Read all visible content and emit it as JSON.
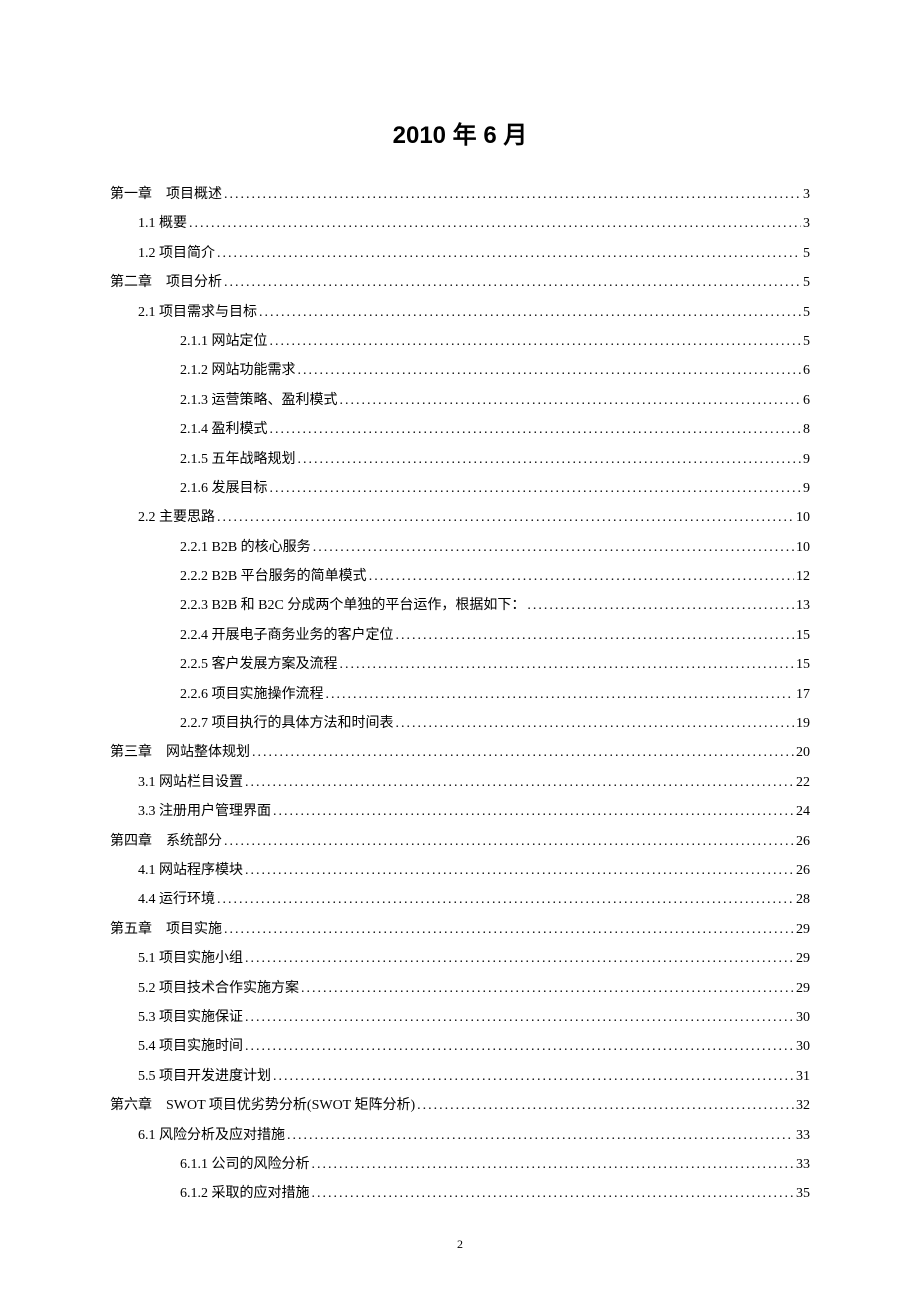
{
  "title": "2010 年 6 月",
  "page_number": "2",
  "toc": [
    {
      "level": 0,
      "label": "第一章　项目概述",
      "page": "3"
    },
    {
      "level": 1,
      "label": "1.1 概要",
      "page": "3"
    },
    {
      "level": 1,
      "label": "1.2 项目简介",
      "page": "5"
    },
    {
      "level": 0,
      "label": "第二章　项目分析",
      "page": "5"
    },
    {
      "level": 1,
      "label": "2.1 项目需求与目标",
      "page": "5"
    },
    {
      "level": 2,
      "label": "2.1.1 网站定位",
      "page": "5"
    },
    {
      "level": 2,
      "label": "2.1.2 网站功能需求",
      "page": "6"
    },
    {
      "level": 2,
      "label": "2.1.3 运营策略、盈利模式",
      "page": "6"
    },
    {
      "level": 2,
      "label": "2.1.4 盈利模式",
      "page": "8"
    },
    {
      "level": 2,
      "label": "2.1.5 五年战略规划",
      "page": "9"
    },
    {
      "level": 2,
      "label": "2.1.6 发展目标",
      "page": "9"
    },
    {
      "level": 1,
      "label": "2.2 主要思路",
      "page": "10"
    },
    {
      "level": 2,
      "label": "2.2.1 B2B 的核心服务",
      "page": "10"
    },
    {
      "level": 2,
      "label": "2.2.2 B2B 平台服务的简单模式",
      "page": "12"
    },
    {
      "level": 2,
      "label": "2.2.3 B2B 和 B2C 分成两个单独的平台运作，根据如下：",
      "page": "13"
    },
    {
      "level": 2,
      "label": "2.2.4 开展电子商务业务的客户定位",
      "page": "15"
    },
    {
      "level": 2,
      "label": "2.2.5 客户发展方案及流程",
      "page": "15"
    },
    {
      "level": 2,
      "label": "2.2.6 项目实施操作流程",
      "page": "17"
    },
    {
      "level": 2,
      "label": "2.2.7 项目执行的具体方法和时间表",
      "page": "19"
    },
    {
      "level": 0,
      "label": "第三章　网站整体规划",
      "page": "20"
    },
    {
      "level": 1,
      "label": "3.1 网站栏目设置",
      "page": "22"
    },
    {
      "level": 1,
      "label": "3.3 注册用户管理界面",
      "page": "24"
    },
    {
      "level": 0,
      "label": "第四章　系统部分",
      "page": "26"
    },
    {
      "level": 1,
      "label": "4.1 网站程序模块",
      "page": "26"
    },
    {
      "level": 1,
      "label": "4.4 运行环境",
      "page": "28"
    },
    {
      "level": 0,
      "label": "第五章　项目实施",
      "page": "29"
    },
    {
      "level": 1,
      "label": "5.1 项目实施小组",
      "page": "29"
    },
    {
      "level": 1,
      "label": "5.2 项目技术合作实施方案",
      "page": "29"
    },
    {
      "level": 1,
      "label": "5.3 项目实施保证",
      "page": "30"
    },
    {
      "level": 1,
      "label": "5.4 项目实施时间",
      "page": "30"
    },
    {
      "level": 1,
      "label": "5.5 项目开发进度计划",
      "page": "31"
    },
    {
      "level": 0,
      "label": "第六章　SWOT 项目优劣势分析(SWOT 矩阵分析)",
      "page": "32"
    },
    {
      "level": 1,
      "label": "6.1 风险分析及应对措施",
      "page": "33"
    },
    {
      "level": 2,
      "label": "6.1.1 公司的风险分析",
      "page": "33"
    },
    {
      "level": 2,
      "label": "6.1.2 采取的应对措施",
      "page": "35"
    }
  ]
}
